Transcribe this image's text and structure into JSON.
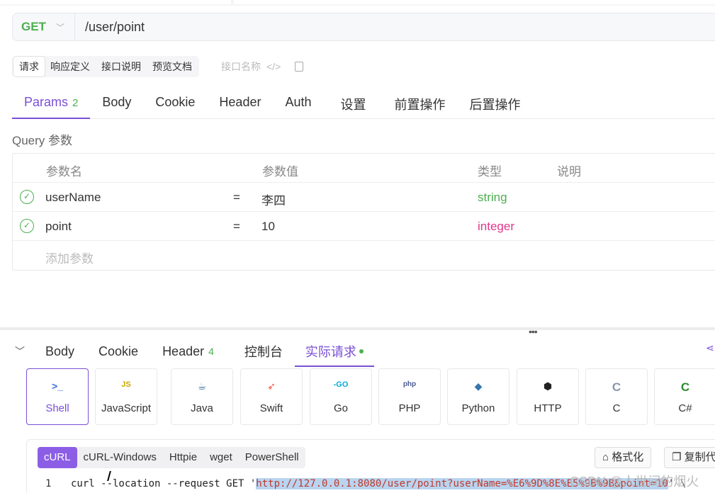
{
  "url_bar": {
    "method": "GET",
    "path": "/user/point"
  },
  "doc_tabs": [
    {
      "label": "请求",
      "active": true
    },
    {
      "label": "响应定义",
      "active": false
    },
    {
      "label": "接口说明",
      "active": false
    },
    {
      "label": "预览文档",
      "active": false
    }
  ],
  "doc_name_placeholder": "接口名称",
  "request_tabs": [
    {
      "label": "Params",
      "count": "2",
      "active": true
    },
    {
      "label": "Body",
      "count": ""
    },
    {
      "label": "Cookie",
      "count": ""
    },
    {
      "label": "Header",
      "count": ""
    },
    {
      "label": "Auth",
      "count": ""
    },
    {
      "label": "设置",
      "count": ""
    },
    {
      "label": "前置操作",
      "count": ""
    },
    {
      "label": "后置操作",
      "count": ""
    }
  ],
  "query_section_label": "Query 参数",
  "params_table": {
    "headers": {
      "name": "参数名",
      "value": "参数值",
      "type": "类型",
      "desc": "说明"
    },
    "rows": [
      {
        "name": "userName",
        "eq": "=",
        "value": "李四",
        "type": "string"
      },
      {
        "name": "point",
        "eq": "=",
        "value": "10",
        "type": "integer"
      }
    ],
    "add_placeholder": "添加参数"
  },
  "response_tabs": [
    {
      "label": "Body",
      "count": ""
    },
    {
      "label": "Cookie",
      "count": ""
    },
    {
      "label": "Header",
      "count": "4"
    },
    {
      "label": "控制台",
      "count": ""
    },
    {
      "label": "实际请求",
      "count": "",
      "active": true
    }
  ],
  "languages": [
    {
      "label": "Shell",
      "icon": ">_",
      "active": true
    },
    {
      "label": "JavaScript",
      "icon": "JS"
    },
    {
      "label": "Java",
      "icon": "☕"
    },
    {
      "label": "Swift",
      "icon": "➶"
    },
    {
      "label": "Go",
      "icon": "-GO"
    },
    {
      "label": "PHP",
      "icon": "php"
    },
    {
      "label": "Python",
      "icon": "◆"
    },
    {
      "label": "HTTP",
      "icon": "⬢"
    },
    {
      "label": "C",
      "icon": "C"
    },
    {
      "label": "C#",
      "icon": "C"
    }
  ],
  "code_variants": [
    {
      "label": "cURL",
      "active": true
    },
    {
      "label": "cURL-Windows"
    },
    {
      "label": "Httpie"
    },
    {
      "label": "wget"
    },
    {
      "label": "PowerShell"
    }
  ],
  "format_button": "格式化",
  "copy_button": "复制代",
  "code_line": {
    "number": "1",
    "prefix": "curl --location --request GET '",
    "highlighted": "http://127.0.0.1:8080/user/point?userName=%E6%9D%8E%E5%9B%9B&point=10",
    "suffix": "' \\"
  },
  "watermark": "CSDN @人世间的烟火",
  "colors": {
    "accent": "#7a4fd6",
    "success": "#4caf50",
    "integer": "#e0378c"
  }
}
